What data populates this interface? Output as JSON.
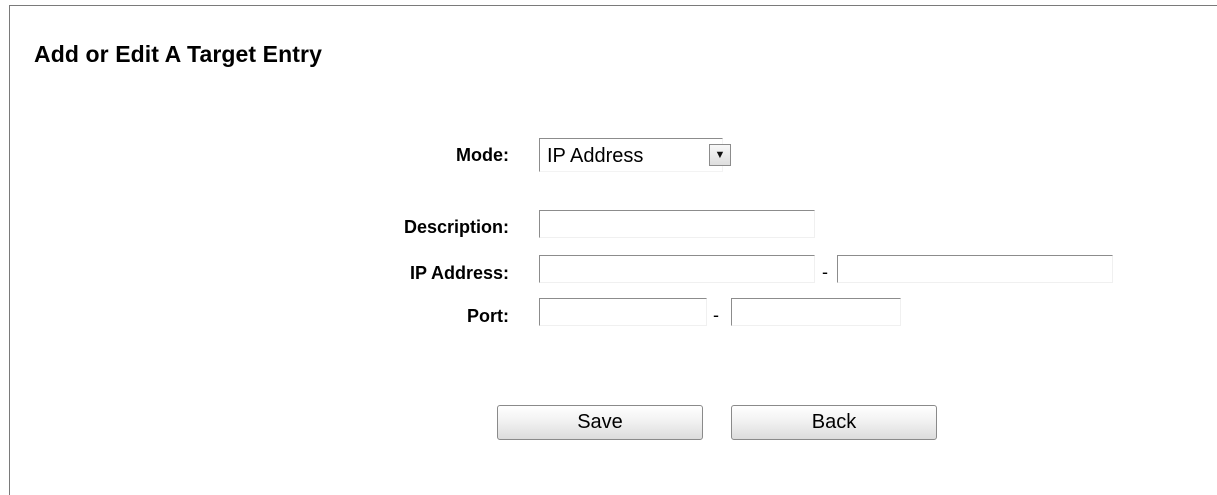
{
  "page": {
    "title": "Add or Edit A Target Entry"
  },
  "form": {
    "mode_label": "Mode:",
    "mode_value": "IP Address",
    "description_label": "Description:",
    "description_value": "",
    "ip_label": "IP Address:",
    "ip_start_value": "",
    "ip_end_value": "",
    "port_label": "Port:",
    "port_start_value": "",
    "port_end_value": "",
    "range_separator": "-"
  },
  "actions": {
    "save_label": "Save",
    "back_label": "Back"
  }
}
